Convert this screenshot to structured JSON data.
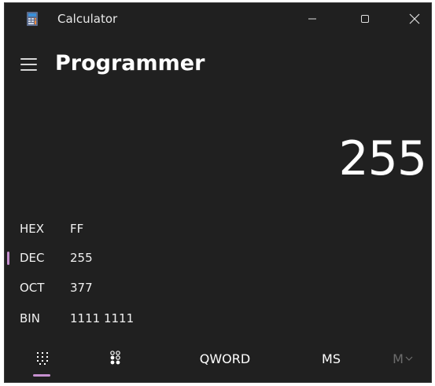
{
  "window": {
    "title": "Calculator"
  },
  "header": {
    "mode": "Programmer"
  },
  "display": {
    "value": "255"
  },
  "radix": [
    {
      "label": "HEX",
      "value": "FF",
      "selected": false
    },
    {
      "label": "DEC",
      "value": "255",
      "selected": true
    },
    {
      "label": "OCT",
      "value": "377",
      "selected": false
    },
    {
      "label": "BIN",
      "value": "1111 1111",
      "selected": false
    }
  ],
  "toolbar": {
    "keypad_icon": "keypad-grid-icon",
    "bit_toggle_icon": "bit-toggle-icon",
    "word_size": "QWORD",
    "memory_store": "MS",
    "memory_recall": "M",
    "memory_recall_icon": "chevron-down-icon"
  },
  "colors": {
    "background": "#202020",
    "accent": "#c690cf",
    "text": "#ffffff",
    "disabled_text": "#6d6d6d"
  }
}
